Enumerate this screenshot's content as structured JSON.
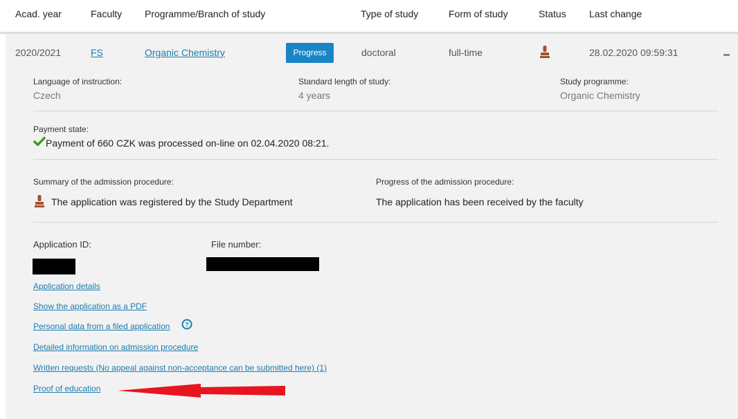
{
  "header": {
    "acad_year": "Acad. year",
    "faculty": "Faculty",
    "programme": "Programme/Branch of study",
    "type": "Type of study",
    "form": "Form of study",
    "status": "Status",
    "last_change": "Last change"
  },
  "row": {
    "acad_year": "2020/2021",
    "faculty": "FS",
    "programme": "Organic Chemistry",
    "badge": "Progress",
    "type": "doctoral",
    "form": "full-time",
    "status_icon": "stamp-icon",
    "last_change": "28.02.2020 09:59:31",
    "collapse_label": "–"
  },
  "details": {
    "language_label": "Language of instruction:",
    "language_value": "Czech",
    "length_label": "Standard length of study:",
    "length_value": "4 years",
    "programme_label": "Study programme:",
    "programme_value": "Organic Chemistry",
    "payment_label": "Payment state:",
    "payment_value": "Payment of 660 CZK was processed on-line on 02.04.2020 08:21.",
    "summary_label": "Summary of the admission procedure:",
    "summary_value": "The application was registered by the Study Department",
    "progress_label": "Progress of the admission procedure:",
    "progress_value": "The application has been received by the faculty",
    "app_id_label": "Application ID:",
    "file_number_label": "File number:"
  },
  "links": {
    "app_details": "Application details",
    "pdf": "Show the application as a PDF",
    "personal_data": "Personal data from a filed application",
    "detailed_info": "Detailed information on admission procedure",
    "written_requests": "Written requests (No appeal against non-acceptance can be submitted here) (1)",
    "proof": "Proof of education"
  },
  "colors": {
    "accent": "#1a85c6",
    "link": "#1a7bb0",
    "check": "#3a9a1e",
    "stamp": "#a0522d",
    "arrow": "#e8141e"
  }
}
